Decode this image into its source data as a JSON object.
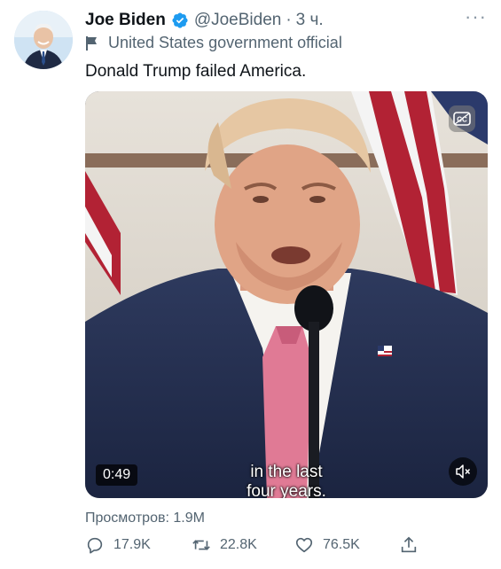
{
  "tweet": {
    "author_name": "Joe Biden",
    "handle": "@JoeBiden",
    "separator": "·",
    "time": "3 ч.",
    "account_label": "United States government official",
    "text": "Donald Trump failed America.",
    "more_icon": "more-dots-icon"
  },
  "media": {
    "duration": "0:49",
    "caption_line1": "in the last",
    "caption_line2": "four years.",
    "mute_icon": "speaker-muted-icon",
    "cc_icon": "closed-captions-icon"
  },
  "views": "Просмотров: 1.9M",
  "actions": {
    "replies": "17.9K",
    "retweets": "22.8K",
    "likes": "76.5K"
  },
  "colors": {
    "brand_blue": "#1d9bf0",
    "secondary_text": "#536471"
  }
}
